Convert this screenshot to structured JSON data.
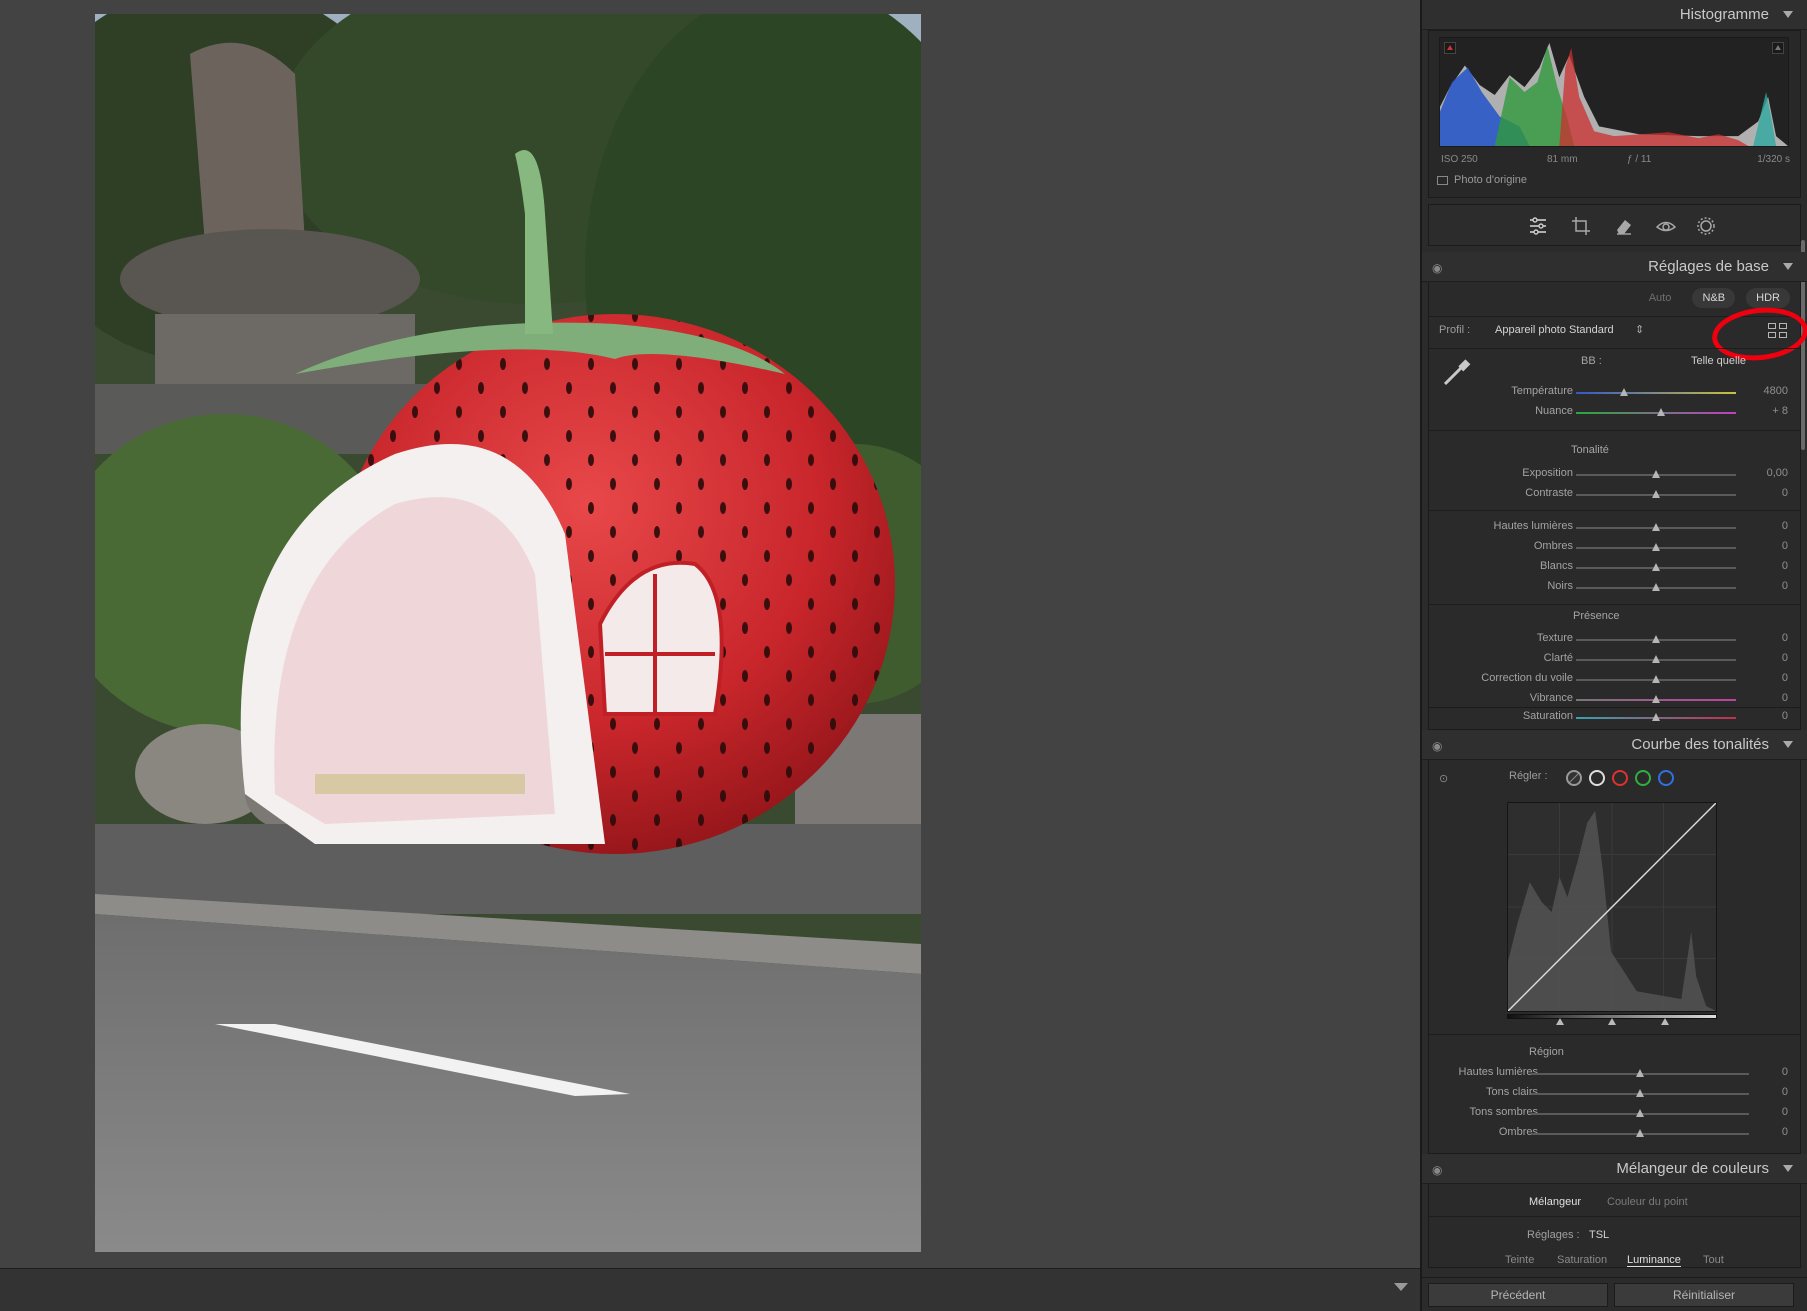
{
  "histogram": {
    "title": "Histogramme",
    "exif": {
      "iso": "ISO 250",
      "focal": "81 mm",
      "aperture": "ƒ / 11",
      "shutter": "1/320 s"
    },
    "original_photo_label": "Photo d'origine"
  },
  "tools": [
    "edit-sliders-icon",
    "crop-icon",
    "healing-eraser-icon",
    "red-eye-icon",
    "masking-icon"
  ],
  "basic": {
    "title": "Réglages de base",
    "tabs": {
      "auto": "Auto",
      "bw": "N&B",
      "hdr": "HDR"
    },
    "profile_label": "Profil :",
    "profile_value": "Appareil photo Standard",
    "wb_label": "BB :",
    "wb_value": "Telle quelle",
    "temperature": {
      "label": "Température",
      "value": "4800",
      "pos": 0.3
    },
    "tint": {
      "label": "Nuance",
      "value": "+ 8",
      "pos": 0.53
    },
    "tone_header": "Tonalité",
    "exposure": {
      "label": "Exposition",
      "value": "0,00"
    },
    "contrast": {
      "label": "Contraste",
      "value": "0"
    },
    "highlights": {
      "label": "Hautes lumières",
      "value": "0"
    },
    "shadows": {
      "label": "Ombres",
      "value": "0"
    },
    "whites": {
      "label": "Blancs",
      "value": "0"
    },
    "blacks": {
      "label": "Noirs",
      "value": "0"
    },
    "presence_header": "Présence",
    "texture": {
      "label": "Texture",
      "value": "0"
    },
    "clarity": {
      "label": "Clarté",
      "value": "0"
    },
    "dehaze": {
      "label": "Correction du voile",
      "value": "0"
    },
    "vibrance": {
      "label": "Vibrance",
      "value": "0"
    },
    "saturation": {
      "label": "Saturation",
      "value": "0"
    }
  },
  "curve": {
    "title": "Courbe des tonalités",
    "adjust_label": "Régler :",
    "region_header": "Région",
    "highlights": {
      "label": "Hautes lumières",
      "value": "0"
    },
    "lights": {
      "label": "Tons clairs",
      "value": "0"
    },
    "darks": {
      "label": "Tons sombres",
      "value": "0"
    },
    "shadows": {
      "label": "Ombres",
      "value": "0"
    }
  },
  "mixer": {
    "title": "Mélangeur de couleurs",
    "tab_mixer": "Mélangeur",
    "tab_point": "Couleur du point",
    "adjust_label": "Réglages :",
    "adjust_value": "TSL",
    "sub_hue": "Teinte",
    "sub_sat": "Saturation",
    "sub_lum": "Luminance",
    "sub_all": "Tout"
  },
  "footer": {
    "previous": "Précédent",
    "reset": "Réinitialiser"
  },
  "colors": {
    "annotation": "#f0000e",
    "panel": "#2b2b2b",
    "canvas": "#434343"
  }
}
